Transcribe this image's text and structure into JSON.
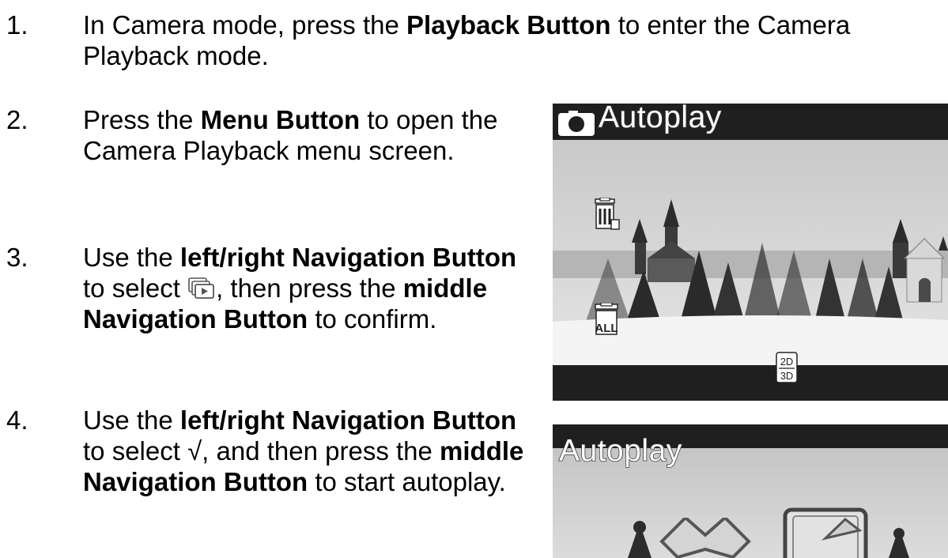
{
  "steps": [
    {
      "number": "1.",
      "parts": [
        "In Camera mode, press the ",
        "Playback Button",
        " to enter the Camera Playback mode."
      ]
    },
    {
      "number": "2.",
      "parts": [
        "Press the ",
        "Menu Button",
        " to open the Camera Playback menu screen."
      ]
    },
    {
      "number": "3.",
      "parts": [
        "Use the ",
        "left/right Navigation Button",
        " to select ",
        ", then press the ",
        "middle Navigation Button",
        " to confirm."
      ]
    },
    {
      "number": "4.",
      "parts": [
        "Use the ",
        "left/right Navigation Button",
        " to select √, and then press the ",
        "middle Navigation Button",
        " to start autoplay."
      ]
    }
  ],
  "screens": [
    {
      "title": "Autoplay",
      "icons": [
        "camera-icon",
        "delete-one-icon",
        "delete-all-icon",
        "autoplay-icon",
        "2d-3d-icon"
      ],
      "badge_top": "2D",
      "badge_bottom": "3D"
    },
    {
      "title": "Autoplay",
      "icons": [
        "cancel-x-icon",
        "confirm-check-icon"
      ]
    }
  ],
  "icons": {
    "step3_inline": "autoplay-icon"
  }
}
